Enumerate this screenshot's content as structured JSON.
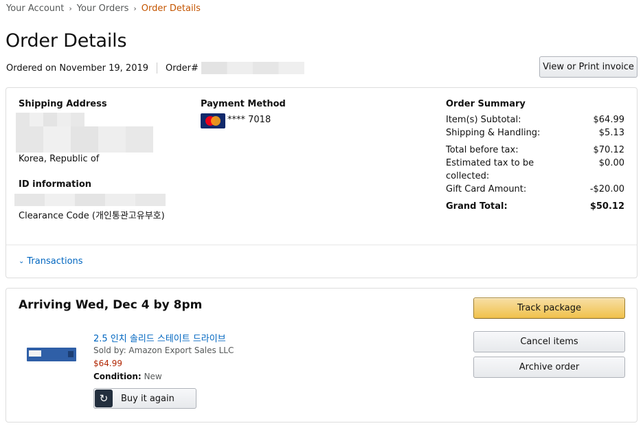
{
  "breadcrumb": {
    "items": [
      "Your Account",
      "Your Orders",
      "Order Details"
    ],
    "separator": "›"
  },
  "page_title": "Order Details",
  "order_meta": {
    "ordered_on": "Ordered on November 19, 2019",
    "order_label": "Order#"
  },
  "buttons": {
    "invoice": "View or Print invoice",
    "track": "Track package",
    "cancel": "Cancel items",
    "archive": "Archive order",
    "buy_again": "Buy it again"
  },
  "shipping": {
    "heading": "Shipping Address",
    "country": "Korea, Republic of"
  },
  "id_info": {
    "heading": "ID information",
    "clearance": "Clearance Code (개인통관고유부호)"
  },
  "payment": {
    "heading": "Payment Method",
    "card_last4": "**** 7018",
    "card_brand_icon": "mastercard-icon"
  },
  "summary": {
    "heading": "Order Summary",
    "rows": [
      {
        "label": "Item(s) Subtotal:",
        "value": "$64.99"
      },
      {
        "label": "Shipping & Handling:",
        "value": "$5.13"
      },
      {
        "label": "Total before tax:",
        "value": "$70.12"
      },
      {
        "label": "Estimated tax to be",
        "value": "$0.00"
      },
      {
        "label": "collected:",
        "value": ""
      },
      {
        "label": "Gift Card Amount:",
        "value": "-$20.00"
      },
      {
        "label": "Grand Total:",
        "value": "$50.12"
      }
    ]
  },
  "transactions": "Transactions",
  "shipment": {
    "arriving": "Arriving Wed, Dec 4 by 8pm",
    "product_title": "2.5 인치 솔리드 스테이트 드라이브",
    "sold_by": "Sold by: Amazon Export Sales LLC",
    "price": "$64.99",
    "condition_label": "Condition:",
    "condition_value": "New"
  },
  "colors": {
    "link": "#0066c0",
    "breadcrumb_current": "#c45500",
    "price": "#b12704",
    "primary_button": "#f0c14b"
  }
}
